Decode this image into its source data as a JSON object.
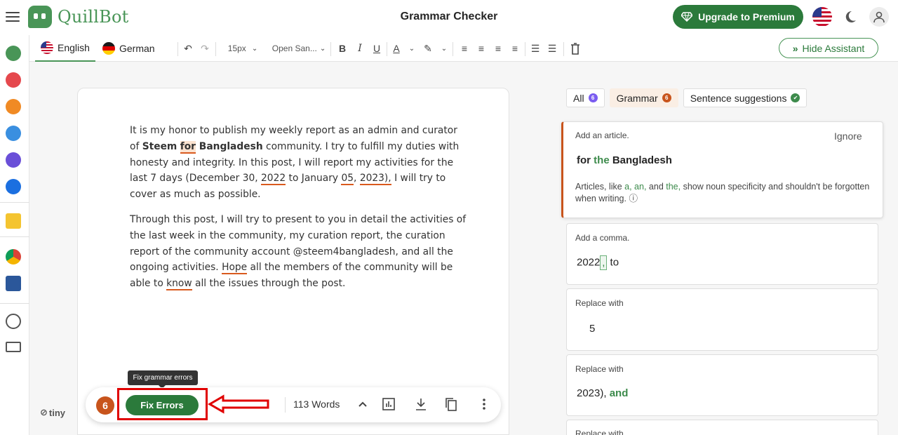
{
  "header": {
    "logo_text": "QuillBot",
    "page_title": "Grammar Checker",
    "premium_label": "Upgrade to Premium"
  },
  "toolbar": {
    "languages": [
      {
        "label": "English",
        "flag": "us",
        "active": true
      },
      {
        "label": "German",
        "flag": "de",
        "active": false
      }
    ],
    "font_size": "15px",
    "font_family": "Open San...",
    "hide_assistant_label": "Hide Assistant"
  },
  "editor": {
    "para1": {
      "t1": "It is my honor to publish my weekly report as an admin and curator of ",
      "b1": "Steem",
      "sp": " ",
      "err1": "for",
      "b2": " Bangladesh",
      "t2": " community. I try to fulfill my duties with honesty and integrity. In this post, I will report my activities for the last 7 days (December 30, ",
      "err2": "2022",
      "t3": " to January ",
      "err3": "05",
      "t4": ", ",
      "err4": "2023),",
      "t5": " I will try to cover as much as possible."
    },
    "para2": {
      "t1": "Through this post, I will try to present to you in detail the activities of the last week in the community, my curation report, the curation report of the community account @steem4bangladesh, and all the ongoing activities. ",
      "err1": "Hope",
      "t2": " all the members of the community will be able to ",
      "err2": "know",
      "t3": " all the issues through the post."
    },
    "tiny_label": "tiny"
  },
  "fix_bar": {
    "tooltip": "Fix grammar errors",
    "error_count": "6",
    "fix_label": "Fix Errors",
    "word_count": "113 Words"
  },
  "panel": {
    "filters": [
      {
        "label": "All",
        "count": "6",
        "color": "#7a5cf0"
      },
      {
        "label": "Grammar",
        "count": "6",
        "color": "#c8541c"
      },
      {
        "label": "Sentence suggestions",
        "count": "✔",
        "color": "#3d8b4c"
      }
    ],
    "card1": {
      "label": "Add an article.",
      "ignore": "Ignore",
      "pre": "for ",
      "ins": "the",
      "post": " Bangladesh",
      "desc_pre": "Articles, like ",
      "desc_words": "a, an,",
      "desc_mid": " and ",
      "desc_the": "the,",
      "desc_post": " show noun specificity and shouldn't be forgotten when writing.",
      "info_icon": "ⓘ"
    },
    "card2": {
      "label": "Add a comma.",
      "pre": "2022",
      "ins": ",",
      "post": " to"
    },
    "card3": {
      "label": "Replace with",
      "value": "5"
    },
    "card4": {
      "label": "Replace with",
      "pre": "2023), ",
      "green": "and"
    },
    "card5": {
      "label": "Replace with"
    }
  },
  "colors": {
    "brand_green": "#499557",
    "button_green": "#2b7a3b",
    "error_orange": "#c8541c"
  }
}
